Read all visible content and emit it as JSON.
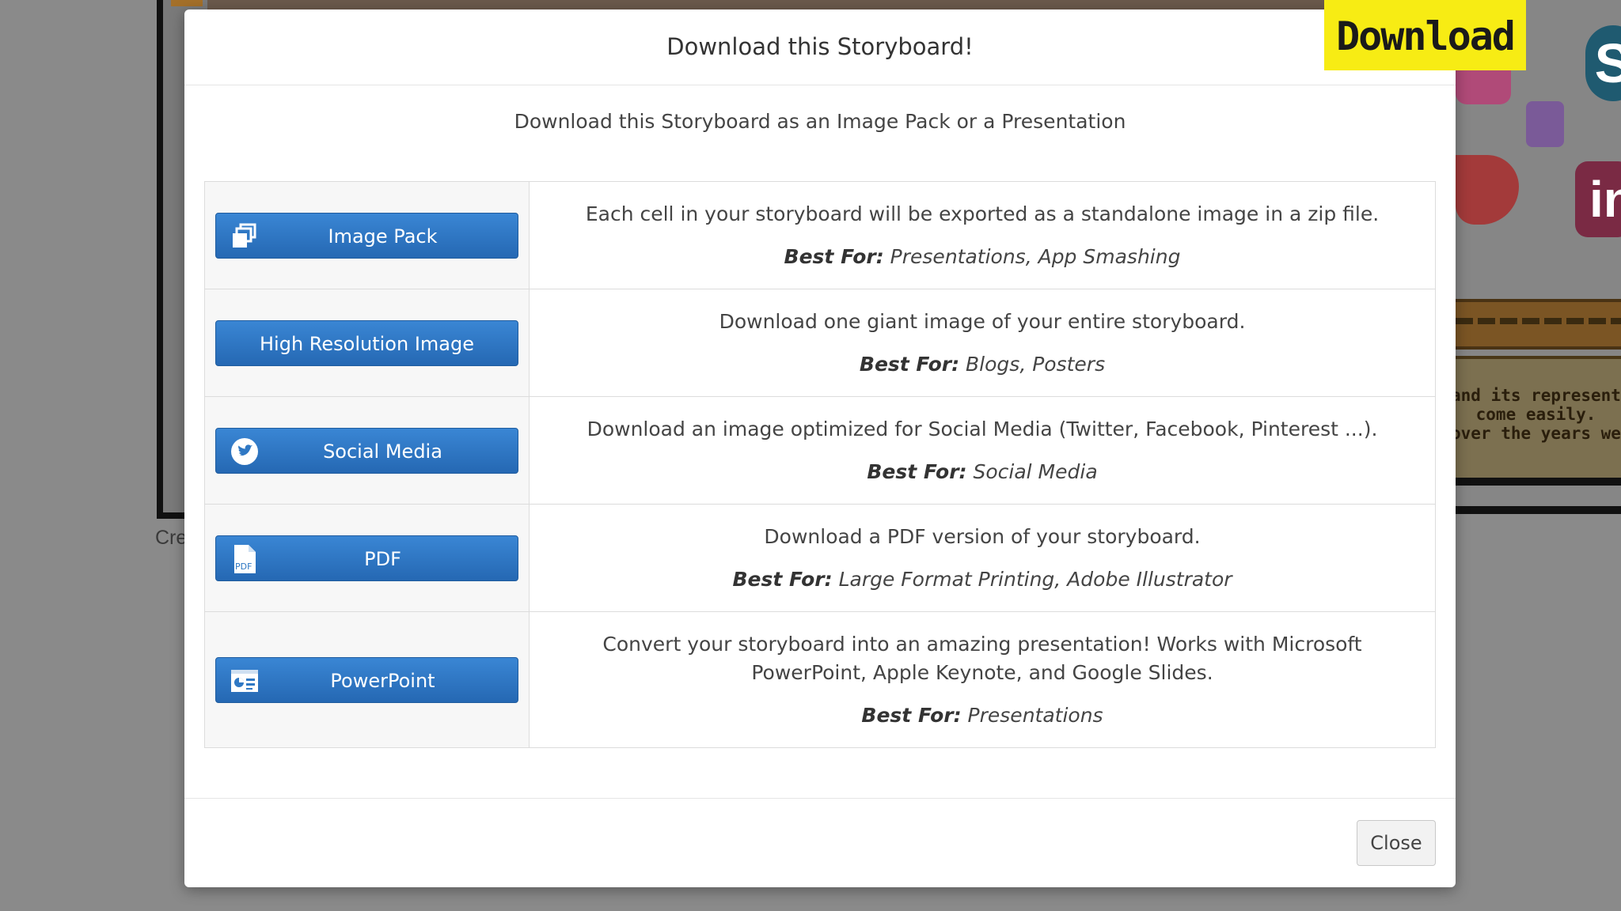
{
  "modal": {
    "title": "Download this Storyboard!",
    "subtitle": "Download this Storyboard as an Image Pack or a Presentation",
    "options": [
      {
        "label": "Image Pack",
        "icon": "image-pack-icon",
        "description": "Each cell in your storyboard will be exported as a standalone image in a zip file.",
        "best_for_label": "Best For:",
        "best_for": "Presentations, App Smashing"
      },
      {
        "label": "High Resolution Image",
        "icon": "",
        "description": "Download one giant image of your entire storyboard.",
        "best_for_label": "Best For:",
        "best_for": "Blogs, Posters"
      },
      {
        "label": "Social Media",
        "icon": "twitter-icon",
        "description": "Download an image optimized for Social Media (Twitter, Facebook, Pinterest ...).",
        "best_for_label": "Best For:",
        "best_for": "Social Media"
      },
      {
        "label": "PDF",
        "icon": "pdf-icon",
        "description": "Download a PDF version of your storyboard.",
        "best_for_label": "Best For:",
        "best_for": "Large Format Printing, Adobe Illustrator"
      },
      {
        "label": "PowerPoint",
        "icon": "powerpoint-icon",
        "description": "Convert your storyboard into an amazing presentation! Works with Microsoft PowerPoint, Apple Keynote, and Google Slides.",
        "best_for_label": "Best For:",
        "best_for": "Presentations"
      }
    ],
    "close_label": "Close"
  },
  "overlay_banner": "Download",
  "background": {
    "cre_text": "Cre",
    "note_lines": [
      "and its representatio",
      "come easily.",
      "over the years were"
    ],
    "skype_glyph": "S",
    "in_glyph": "in"
  },
  "colors": {
    "button_blue": "#2f78c4",
    "banner_yellow": "#f7ec14"
  }
}
